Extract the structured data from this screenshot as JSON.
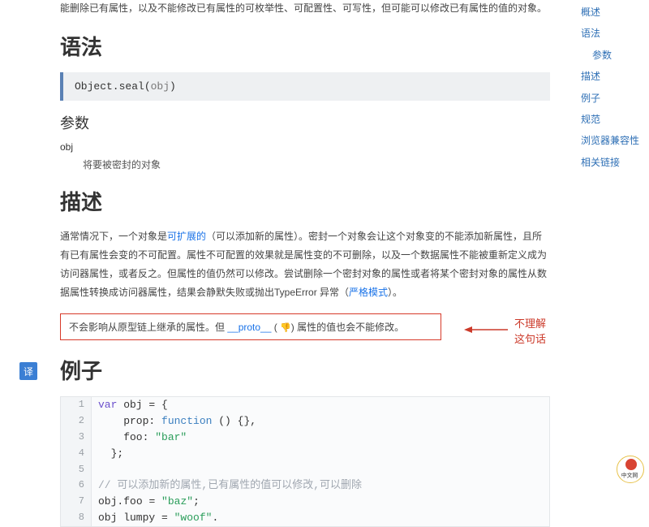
{
  "intro": "能删除已有属性，以及不能修改已有属性的可枚举性、可配置性、可写性，但可能可以修改已有属性的值的对象。",
  "headings": {
    "syntax": "语法",
    "params": "参数",
    "description": "描述",
    "example": "例子"
  },
  "syntax_code": {
    "prefix": "Object.seal(",
    "arg": "obj",
    "suffix": ")"
  },
  "param": {
    "name": "obj",
    "desc": "将要被密封的对象"
  },
  "description_para": {
    "p1": "通常情况下，一个对象是",
    "link1": "可扩展的",
    "p2": "（可以添加新的属性）。密封一个对象会让这个对象变的不能添加新属性，且所有已有属性会变的不可配置。属性不可配置的效果就是属性变的不可删除，以及一个数据属性不能被重新定义成为访问器属性，或者反之。但属性的值仍然可以修改。尝试删除一个密封对象的属性或者将某个密封对象的属性从数据属性转换成访问器属性，结果会静默失败或抛出TypeError 异常（",
    "link2": "严格模式",
    "p3": "）。"
  },
  "note": {
    "pre": "不会影响从原型链上继承的属性。但 ",
    "proto": "__proto__",
    "thumbs": "👎",
    "post": " 属性的值也会不能修改。",
    "open": " ( ",
    "close": ") "
  },
  "callout": "不理解这句话",
  "code_lines": [
    {
      "n": "1",
      "tokens": [
        [
          "var",
          "k-var"
        ],
        [
          " obj ",
          "k-prop"
        ],
        [
          "=",
          "k-op"
        ],
        [
          " {",
          ""
        ]
      ]
    },
    {
      "n": "2",
      "tokens": [
        [
          "    prop",
          "k-prop"
        ],
        [
          ": ",
          "k-op"
        ],
        [
          "function",
          "k-func"
        ],
        [
          " () {},",
          ""
        ]
      ]
    },
    {
      "n": "3",
      "tokens": [
        [
          "    foo",
          "k-prop"
        ],
        [
          ": ",
          "k-op"
        ],
        [
          "\"bar\"",
          "k-str"
        ]
      ]
    },
    {
      "n": "4",
      "tokens": [
        [
          "  };",
          ""
        ]
      ]
    },
    {
      "n": "5",
      "tokens": [
        [
          "",
          ""
        ]
      ]
    },
    {
      "n": "6",
      "tokens": [
        [
          "// 可以添加新的属性,已有属性的值可以修改,可以删除",
          "k-comment"
        ]
      ]
    },
    {
      "n": "7",
      "tokens": [
        [
          "obj",
          "k-prop"
        ],
        [
          ".",
          "k-op"
        ],
        [
          "foo ",
          "k-prop"
        ],
        [
          "= ",
          "k-op"
        ],
        [
          "\"baz\"",
          "k-str"
        ],
        [
          ";",
          ""
        ]
      ]
    },
    {
      "n": "8",
      "tokens": [
        [
          "obj",
          "k-prop"
        ],
        [
          " lumpy ",
          "k-prop"
        ],
        [
          "= ",
          "k-op"
        ],
        [
          "\"woof\"",
          "k-str"
        ],
        [
          ".",
          ""
        ]
      ]
    }
  ],
  "sidebar": [
    {
      "label": "概述",
      "sub": false
    },
    {
      "label": "语法",
      "sub": false
    },
    {
      "label": "参数",
      "sub": true
    },
    {
      "label": "描述",
      "sub": false
    },
    {
      "label": "例子",
      "sub": false
    },
    {
      "label": "规范",
      "sub": false
    },
    {
      "label": "浏览器兼容性",
      "sub": false
    },
    {
      "label": "相关链接",
      "sub": false
    }
  ],
  "translate_btn": "译",
  "logo_text": "中文网"
}
